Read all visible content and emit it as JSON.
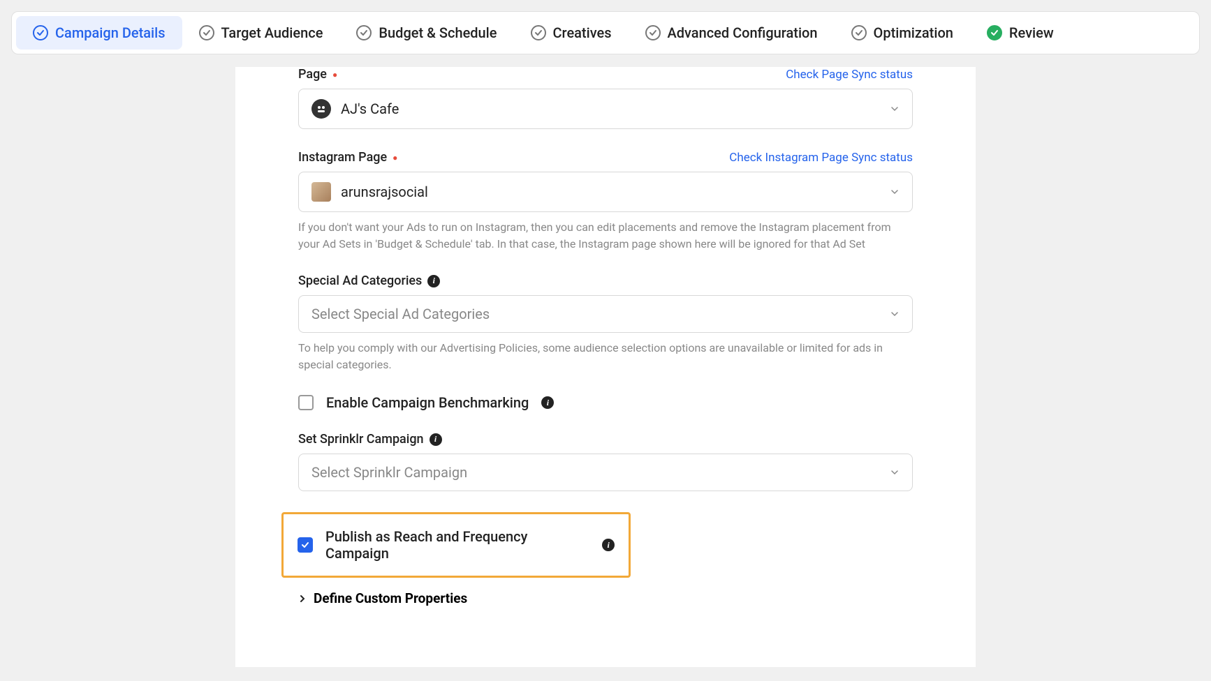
{
  "tabs": [
    {
      "label": "Campaign Details",
      "state": "active"
    },
    {
      "label": "Target Audience",
      "state": "pending"
    },
    {
      "label": "Budget & Schedule",
      "state": "pending"
    },
    {
      "label": "Creatives",
      "state": "pending"
    },
    {
      "label": "Advanced Configuration",
      "state": "pending"
    },
    {
      "label": "Optimization",
      "state": "pending"
    },
    {
      "label": "Review",
      "state": "complete"
    }
  ],
  "form": {
    "page": {
      "label": "Page",
      "required": true,
      "link": "Check Page Sync status",
      "value": "AJ's Cafe"
    },
    "instagram": {
      "label": "Instagram Page",
      "required": true,
      "link": "Check Instagram Page Sync status",
      "value": "arunsrajsocial",
      "help": "If you don't want your Ads to run on Instagram, then you can edit placements and remove the Instagram placement from your Ad Sets in 'Budget & Schedule' tab. In that case, the Instagram page shown here will be ignored for that Ad Set"
    },
    "special": {
      "label": "Special Ad Categories",
      "placeholder": "Select Special Ad Categories",
      "help": "To help you comply with our Advertising Policies, some audience selection options are unavailable or limited for ads in special categories."
    },
    "benchmarking": {
      "label": "Enable Campaign Benchmarking",
      "checked": false
    },
    "sprinklr": {
      "label": "Set Sprinklr Campaign",
      "placeholder": "Select Sprinklr Campaign"
    },
    "reach": {
      "label": "Publish as Reach and Frequency Campaign",
      "checked": true
    },
    "customProps": {
      "label": "Define Custom Properties"
    }
  }
}
